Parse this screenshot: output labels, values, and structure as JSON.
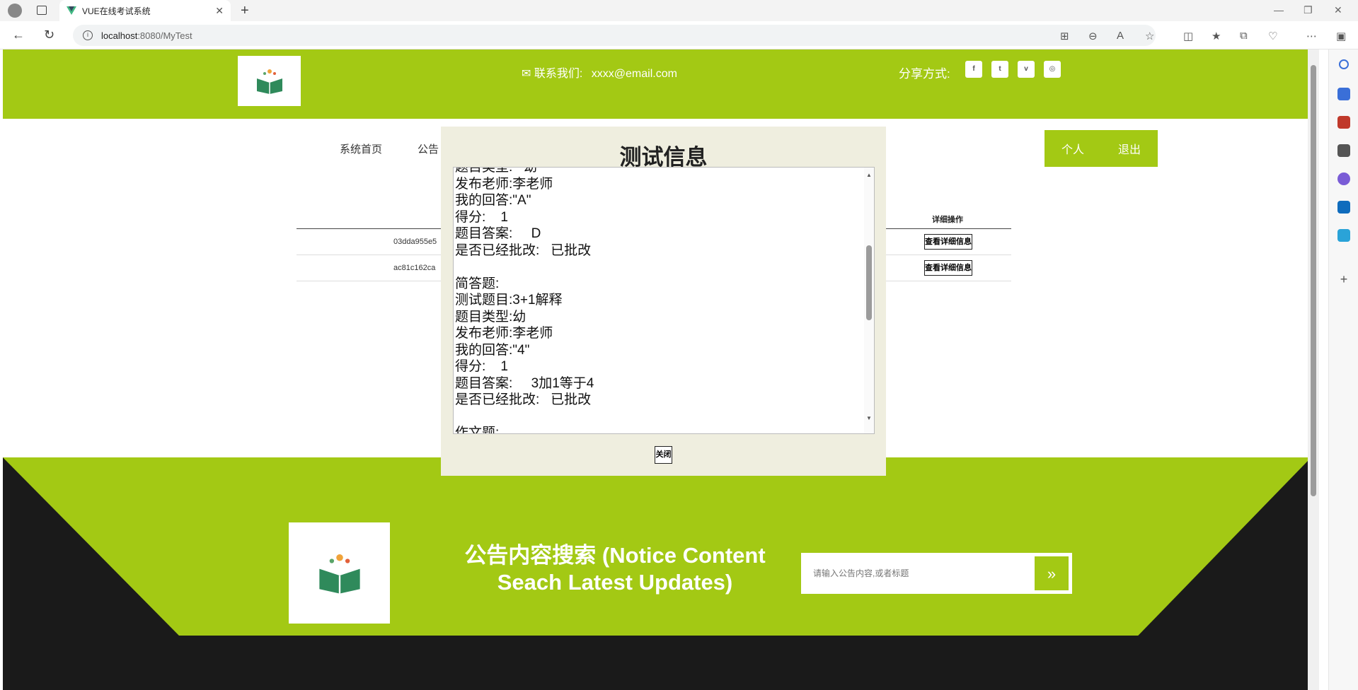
{
  "browser": {
    "tab_title": "VUE在线考试系统",
    "url_host": "localhost",
    "url_rest": ":8080/MyTest"
  },
  "header": {
    "contact_label": "联系我们:",
    "contact_email": "xxxx@email.com",
    "share_label": "分享方式:",
    "social": [
      "f",
      "t",
      "v",
      "◎"
    ]
  },
  "nav": {
    "home": "系统首页",
    "notice": "公告",
    "personal": "个人",
    "logout": "退出"
  },
  "table": {
    "detail_header": "详细操作",
    "rows": [
      {
        "id": "03dda955e5",
        "button": "查看详细信息"
      },
      {
        "id": "ac81c162ca",
        "button": "查看详细信息"
      }
    ]
  },
  "modal": {
    "title": "测试信息",
    "content": "题目类型:   幼\n发布老师:李老师\n我的回答:\"A\"\n得分:    1\n题目答案:     D\n是否已经批改:   已批改\n\n简答题:\n测试题目:3+1解释\n题目类型:幼\n发布老师:李老师\n我的回答:\"4\"\n得分:    1\n题目答案:     3加1等于4\n是否已经批改:   已批改\n\n作文题:",
    "close": "关闭"
  },
  "footer": {
    "title": "公告内容搜索 (Notice Content Seach Latest Updates)",
    "search_placeholder": "请输入公告内容,或者标题"
  },
  "colors": {
    "brand_green": "#a3c914",
    "dark": "#1a1a1a",
    "modal_bg": "#efeedf"
  }
}
